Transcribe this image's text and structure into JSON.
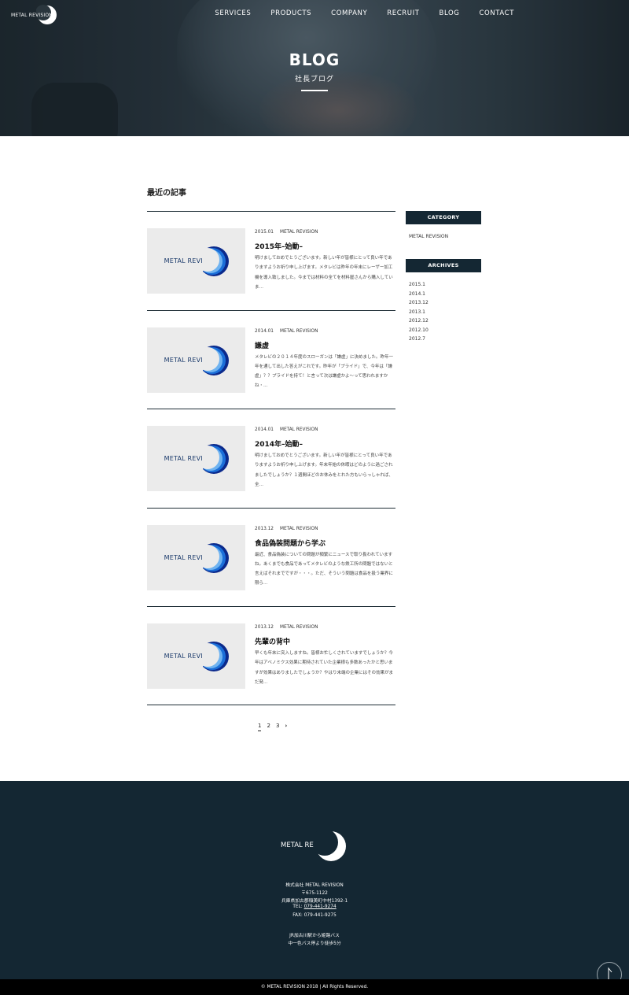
{
  "header": {
    "logo_text": "METAL REVISION",
    "nav": [
      "SERVICES",
      "PRODUCTS",
      "COMPANY",
      "RECRUIT",
      "BLOG",
      "CONTACT"
    ]
  },
  "hero": {
    "title_en": "BLOG",
    "title_jp": "社長ブログ"
  },
  "main": {
    "section_title": "最近の記事",
    "thumb_text": "METAL REVISION",
    "posts": [
      {
        "date": "2015.01",
        "category": "METAL REVISION",
        "title": "2015年–始動–",
        "excerpt": "明けましておめでとうございます。新しい年が皆様にとって良い年でありますようお祈り申し上げます。メタレビは昨年の年末にレーザー加工機を導入致しました。今までは材料の全てを材料屋さんから購入していま…"
      },
      {
        "date": "2014.01",
        "category": "METAL REVISION",
        "title": "謙虚",
        "excerpt": "メタレビの２０１４年度のスローガンは「謙虚」に決めました。昨年一年を通して出した答えがこれです。昨年が「プライド」で、今年は「謙虚」？？プライドを持て！と言って次は謙虚かよ～って思われますかね・…"
      },
      {
        "date": "2014.01",
        "category": "METAL REVISION",
        "title": "2014年–始動–",
        "excerpt": "明けましておめでとうございます。新しい年が皆様にとって良い年でありますようお祈り申し上げます。年末年始の休暇はどのように過ごされましたでしょうか？１週間ほどのお休みをとれた方もいらっしゃれば、全…"
      },
      {
        "date": "2013.12",
        "category": "METAL REVISION",
        "title": "食品偽装問題から学ぶ",
        "excerpt": "最近、食品偽装についての問題が頻繁にニュースで取り扱われていますね。あくまでも食品であってメタレビのような鉄工所の問題ではないと言えばそれまでですが・・・。ただ、そういう問題は食品を扱う業界に限ら…"
      },
      {
        "date": "2013.12",
        "category": "METAL REVISION",
        "title": "先輩の背中",
        "excerpt": "早くも年末に突入しますね。皆様お忙しくされていますでしょうか？今年はアベノミクス効果に期待されていた企業様も多数あったかと思いますが効果はありましたでしょうか？やはり末端の企業にはその効果がまだ発…"
      }
    ],
    "pagination": [
      "1",
      "2",
      "3",
      "›"
    ]
  },
  "sidebar": {
    "category_heading": "CATEGORY",
    "categories": [
      "METAL REVISION"
    ],
    "archives_heading": "ARCHIVES",
    "archives": [
      "2015.1",
      "2014.1",
      "2013.12",
      "2013.1",
      "2012.12",
      "2012.10",
      "2012.7"
    ]
  },
  "footer": {
    "logo_text": "METAL REVISION",
    "company": "株式会社 METAL REVISION",
    "postal": "〒675-1122",
    "address": "兵庫県加古郡稲美町中村1392-1",
    "tel_label": "TEL: ",
    "tel": "079-441-9274",
    "fax": "FAX: 079-441-9275",
    "access1": "JR加古川駅から姫路バス",
    "access2": "中一色バス停より徒歩5分",
    "copyright": "© METAL REVISION 2018 | All Rights Reserved.",
    "top_icon": "arrow-up-icon"
  },
  "colors": {
    "navy": "#142733",
    "logo_blue": "#1b6fd8"
  }
}
